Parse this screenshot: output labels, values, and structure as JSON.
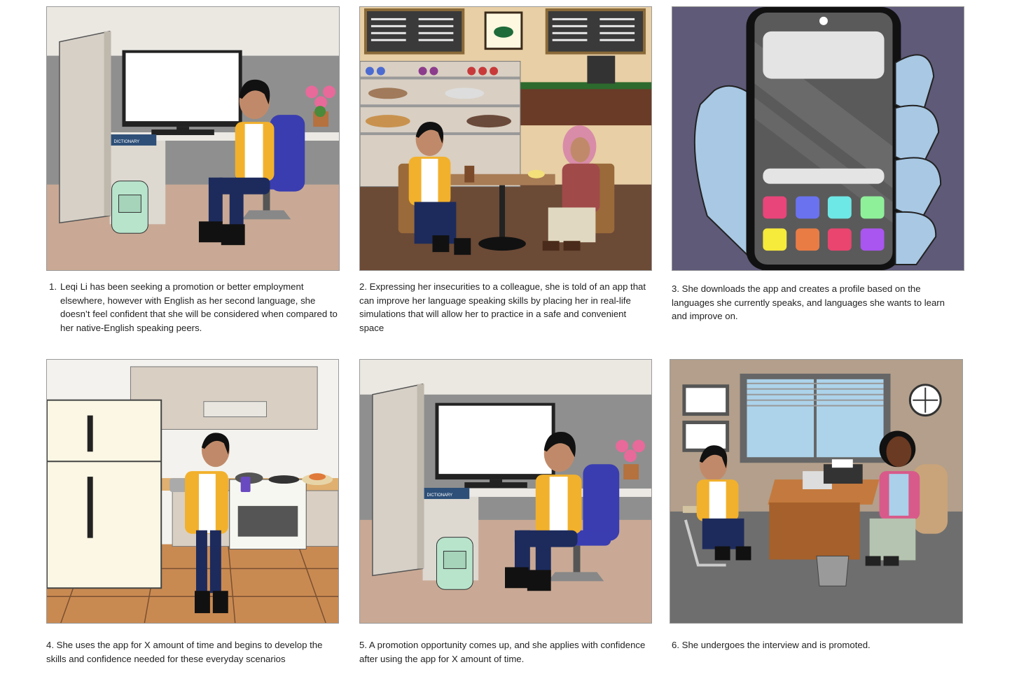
{
  "storyboard": {
    "panels": [
      {
        "number": "1.",
        "caption": "Leqi Li has been seeking a promotion or better employment elsewhere, however with English as her second language, she doesn’t feel confident that she will be considered when compared to her native-English speaking peers.",
        "label": "DICTIONARY"
      },
      {
        "number": "",
        "caption": "2. Expressing her insecurities to a colleague, she is told of an app that can improve her language speaking skills by placing her in real-life simulations that will allow her to practice in a safe and convenient space"
      },
      {
        "number": "",
        "caption": "3. She downloads the app and creates a profile based on the languages she currently speaks, and languages she wants to learn and improve on."
      },
      {
        "number": "",
        "caption": "4. She uses the app for X amount of time and begins to develop the skills and confidence needed for these everyday scenarios"
      },
      {
        "number": "",
        "caption": "5. A promotion opportunity comes up, and she applies with confidence after using the app for X amount of time.",
        "label": "DICTIONARY"
      },
      {
        "number": "",
        "caption": "6. She undergoes the interview and is promoted."
      }
    ],
    "colors": {
      "office_wall": "#ebe8e2",
      "office_wall_dark": "#8f8f8f",
      "office_floor": "#c9a995",
      "cafe_wall": "#e8cfa5",
      "cafe_floor": "#6b4a36",
      "phone_bg": "#5f5a78",
      "kitchen_floor": "#c98a52",
      "interview_wall": "#b39f8b",
      "jacket": "#f2b12c",
      "jeans": "#1d2b5c",
      "chair_blue": "#3a3db0",
      "backpack": "#b8e4cc"
    },
    "app_icons": [
      "#e8457a",
      "#6a72f0",
      "#6ee8e6",
      "#8ff09a",
      "#f6ea3a",
      "#e97c45",
      "#e9456f",
      "#a955f0"
    ]
  }
}
